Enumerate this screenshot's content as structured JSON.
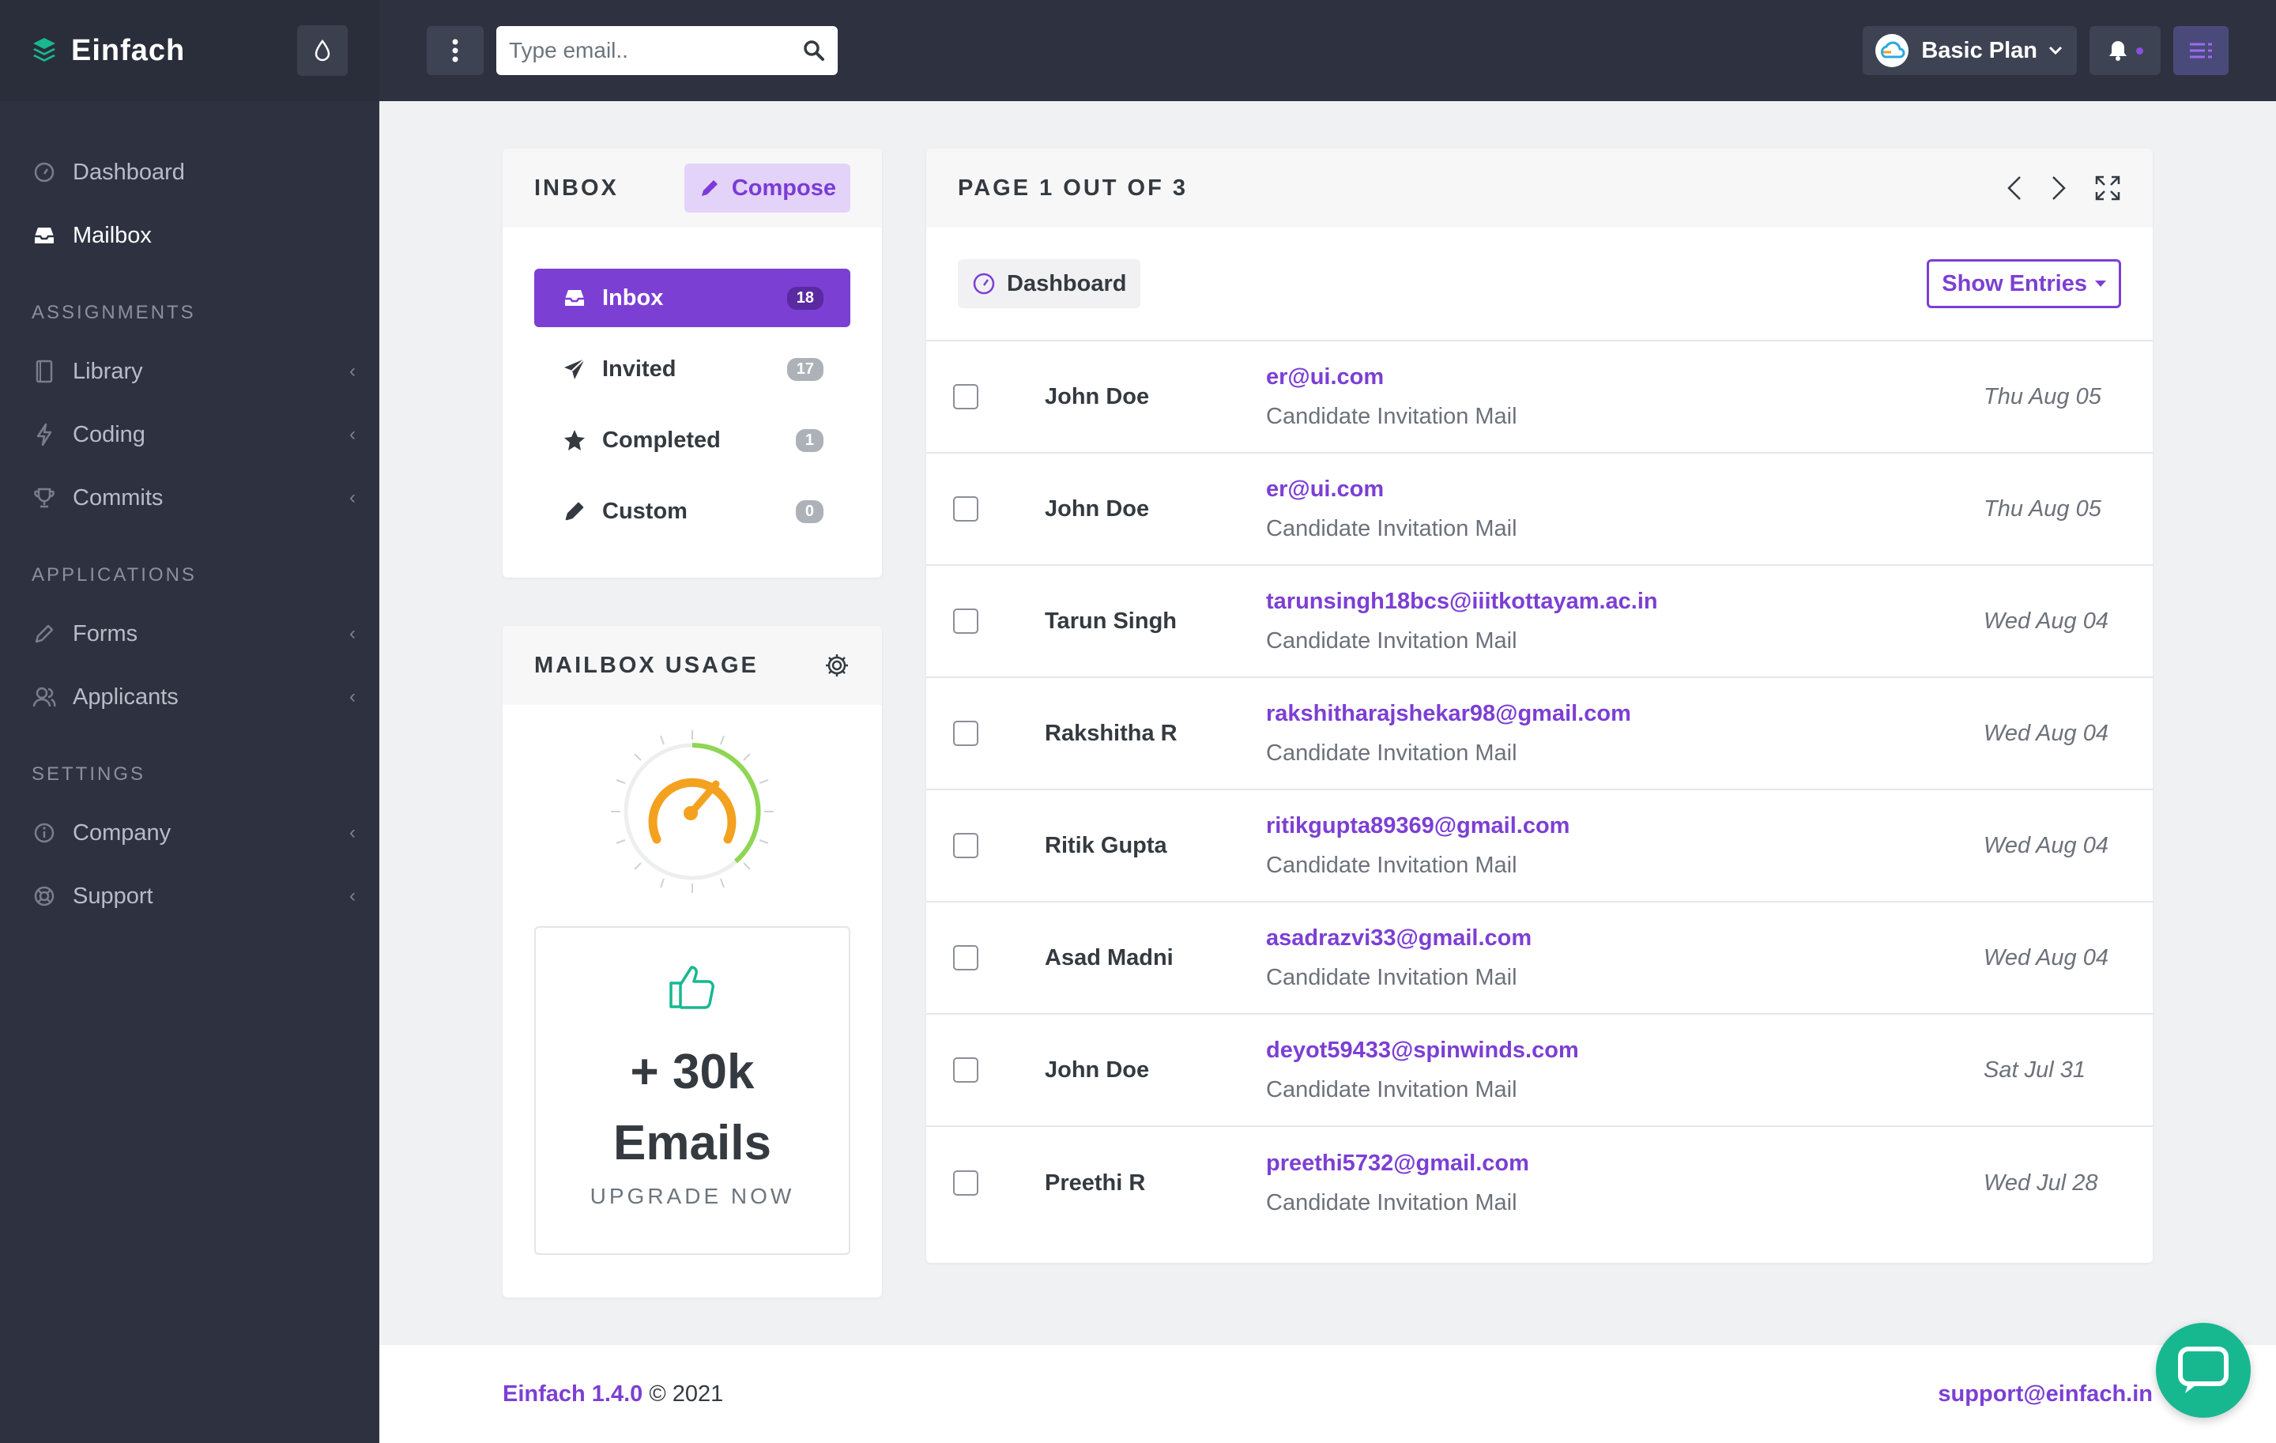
{
  "brand": {
    "name": "Einfach"
  },
  "sidebar": {
    "items_top": [
      {
        "label": "Dashboard",
        "icon": "gauge-icon",
        "active": false
      },
      {
        "label": "Mailbox",
        "icon": "inbox-tray-icon",
        "active": true
      }
    ],
    "sections": [
      {
        "title": "ASSIGNMENTS",
        "items": [
          {
            "label": "Library",
            "icon": "book-icon"
          },
          {
            "label": "Coding",
            "icon": "bolt-icon"
          },
          {
            "label": "Commits",
            "icon": "trophy-icon"
          }
        ]
      },
      {
        "title": "APPLICATIONS",
        "items": [
          {
            "label": "Forms",
            "icon": "pencil-icon"
          },
          {
            "label": "Applicants",
            "icon": "users-icon"
          }
        ]
      },
      {
        "title": "SETTINGS",
        "items": [
          {
            "label": "Company",
            "icon": "info-icon"
          },
          {
            "label": "Support",
            "icon": "lifebuoy-icon"
          }
        ]
      }
    ]
  },
  "topbar": {
    "search_placeholder": "Type email..",
    "plan_label": "Basic Plan"
  },
  "inbox_card": {
    "title": "INBOX",
    "compose_label": "Compose",
    "folders": [
      {
        "label": "Inbox",
        "count": "18",
        "icon": "inbox-tray-icon",
        "active": true
      },
      {
        "label": "Invited",
        "count": "17",
        "icon": "paper-plane-icon",
        "active": false
      },
      {
        "label": "Completed",
        "count": "1",
        "icon": "star-icon",
        "active": false
      },
      {
        "label": "Custom",
        "count": "0",
        "icon": "pencil-icon",
        "active": false
      }
    ]
  },
  "usage_card": {
    "title": "MAILBOX USAGE",
    "big_line1": "+ 30k",
    "big_line2": "Emails",
    "upgrade_label": "UPGRADE NOW"
  },
  "mail_list": {
    "page_label": "PAGE 1 OUT OF 3",
    "breadcrumb": "Dashboard",
    "show_entries_label": "Show Entries",
    "rows": [
      {
        "sender": "John Doe",
        "email": "er@ui.com",
        "subject": "Candidate Invitation Mail",
        "date": "Thu Aug 05"
      },
      {
        "sender": "John Doe",
        "email": "er@ui.com",
        "subject": "Candidate Invitation Mail",
        "date": "Thu Aug 05"
      },
      {
        "sender": "Tarun Singh",
        "email": "tarunsingh18bcs@iiitkottayam.ac.in",
        "subject": "Candidate Invitation Mail",
        "date": "Wed Aug 04"
      },
      {
        "sender": "Rakshitha R",
        "email": "rakshitharajshekar98@gmail.com",
        "subject": "Candidate Invitation Mail",
        "date": "Wed Aug 04"
      },
      {
        "sender": "Ritik Gupta",
        "email": "ritikgupta89369@gmail.com",
        "subject": "Candidate Invitation Mail",
        "date": "Wed Aug 04"
      },
      {
        "sender": "Asad Madni",
        "email": "asadrazvi33@gmail.com",
        "subject": "Candidate Invitation Mail",
        "date": "Wed Aug 04"
      },
      {
        "sender": "John Doe",
        "email": "deyot59433@spinwinds.com",
        "subject": "Candidate Invitation Mail",
        "date": "Sat Jul 31"
      },
      {
        "sender": "Preethi R",
        "email": "preethi5732@gmail.com",
        "subject": "Candidate Invitation Mail",
        "date": "Wed Jul 28"
      }
    ]
  },
  "footer": {
    "version": "Einfach 1.4.0",
    "copyright": "© 2021",
    "support_email": "support@einfach.in"
  },
  "colors": {
    "accent": "#7c3fd4",
    "sidebar": "#2e3240",
    "fab": "#17b890"
  }
}
